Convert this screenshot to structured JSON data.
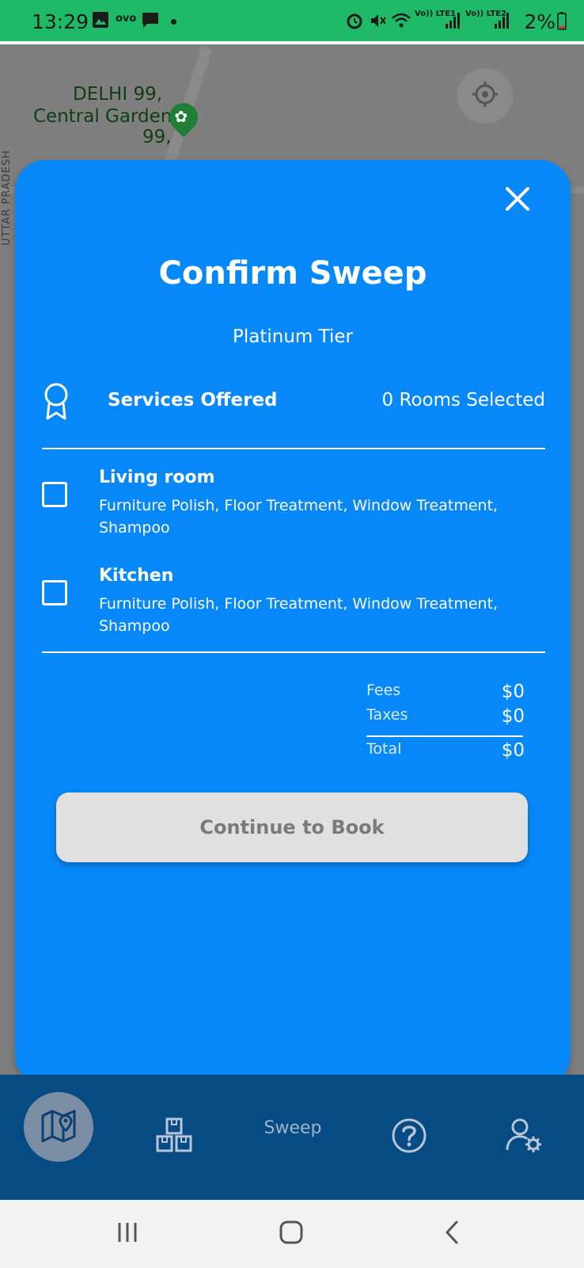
{
  "status_bar": {
    "time": "13:29",
    "carrier_label": "ovo",
    "battery": "2%",
    "network1": "Vo)) LTE1",
    "network2": "Vo)) LTE2"
  },
  "map": {
    "poi_label": "DELHI 99, Central Garden 99,",
    "poi_line1": "DELHI 99,",
    "poi_line2": "Central Garden",
    "poi_line3": "99,",
    "state_label": "UTTAR PRADESH",
    "locate_icon": "crosshair-icon"
  },
  "modal": {
    "title": "Confirm Sweep",
    "tier": "Platinum Tier",
    "services_label": "Services Offered",
    "rooms_selected": "0 Rooms Selected",
    "rooms": [
      {
        "name": "Living room",
        "services": "Furniture Polish, Floor Treatment, Window Treatment, Shampoo",
        "checked": false
      },
      {
        "name": "Kitchen",
        "services": "Furniture Polish, Floor Treatment, Window Treatment, Shampoo",
        "checked": false
      }
    ],
    "fees": {
      "fees_label": "Fees",
      "fees_value": "$0",
      "taxes_label": "Taxes",
      "taxes_value": "$0",
      "total_label": "Total",
      "total_value": "$0"
    },
    "continue_label": "Continue to Book"
  },
  "bottom_nav": {
    "items": [
      {
        "icon": "map-pin-icon",
        "active": true
      },
      {
        "icon": "boxes-icon"
      },
      {
        "label": "Sweep"
      },
      {
        "icon": "help-icon"
      },
      {
        "icon": "user-settings-icon"
      }
    ]
  },
  "colors": {
    "status_bar": "#1fba67",
    "modal_bg": "#0788f8",
    "nav_bg": "#074b85",
    "button_disabled": "#e0e0e0"
  }
}
